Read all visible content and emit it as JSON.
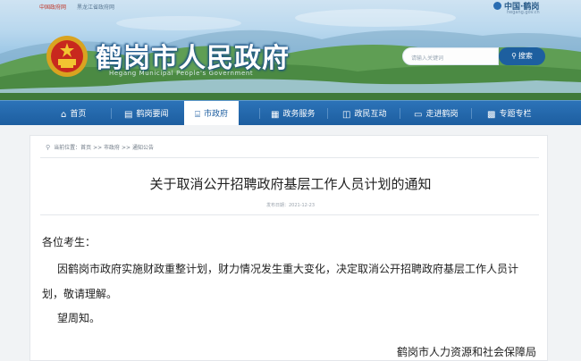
{
  "top_links": [
    "中国政府网",
    "黑龙江省政府网"
  ],
  "brand": {
    "name": "中国·鹤岗",
    "domain": "hegang.gov.cn"
  },
  "site": {
    "title": "鹤岗市人民政府",
    "subtitle": "Hegang Municipal People's Government"
  },
  "search": {
    "placeholder": "请输入关键词",
    "button_label": "搜索"
  },
  "nav": [
    {
      "label": "首页",
      "icon": "home-icon"
    },
    {
      "label": "鹤岗要闻",
      "icon": "news-icon"
    },
    {
      "label": "市政府",
      "icon": "government-building-icon",
      "active": true
    },
    {
      "label": "政务服务",
      "icon": "service-icon"
    },
    {
      "label": "政民互动",
      "icon": "chat-icon"
    },
    {
      "label": "走进鹤岗",
      "icon": "monitor-icon"
    },
    {
      "label": "专题专栏",
      "icon": "grid-icon"
    }
  ],
  "breadcrumb": {
    "prefix": "当前位置：",
    "items": [
      "首页",
      "市政府",
      "通知公告"
    ],
    "separator": " >> "
  },
  "article": {
    "title": "关于取消公开招聘政府基层工作人员计划的通知",
    "date_label": "发布日期：",
    "date": "2021-12-23",
    "salutation": "各位考生：",
    "paragraph_line1": "因鹤岗市政府实施财政重整计划，财力情况发生重大变化，决定取消公开招聘政府基层工作人员计",
    "paragraph_line2": "划，敬请理解。",
    "closing": "望周知。",
    "signature": "鹤岗市人力资源和社会保障局"
  },
  "colors": {
    "nav_bg": "#1d5ea0",
    "nav_active_text": "#1d5ea0",
    "search_button": "#1d5f9f",
    "page_bg": "#f1f3f5"
  }
}
